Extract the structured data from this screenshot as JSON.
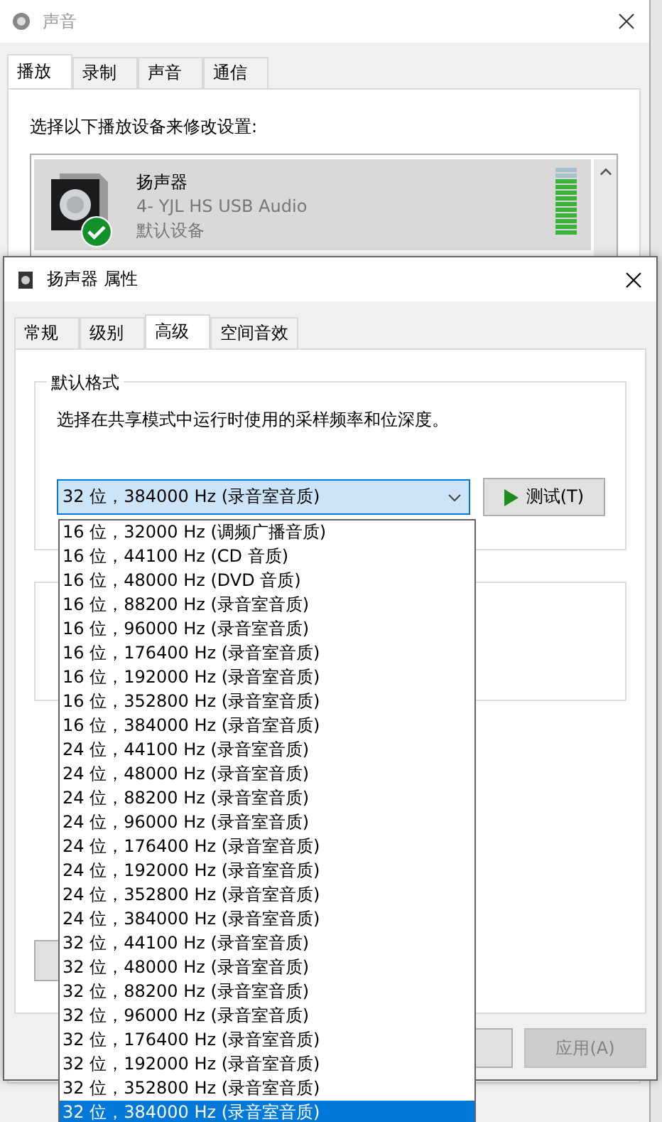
{
  "back_window": {
    "title": "声音",
    "tabs": [
      {
        "label": "播放",
        "selected": true
      },
      {
        "label": "录制",
        "selected": false
      },
      {
        "label": "声音",
        "selected": false
      },
      {
        "label": "通信",
        "selected": false
      }
    ],
    "instruction": "选择以下播放设备来修改设置:",
    "devices": [
      {
        "name": "扬声器",
        "description": "4- YJL HS USB Audio",
        "status": "默认设备",
        "selected": true,
        "is_default": true,
        "level": 0.83
      }
    ]
  },
  "dialog": {
    "title": "扬声器 属性",
    "tabs": [
      {
        "label": "常规",
        "selected": false
      },
      {
        "label": "级别",
        "selected": false
      },
      {
        "label": "高级",
        "selected": true
      },
      {
        "label": "空间音效",
        "selected": false
      }
    ],
    "default_format": {
      "label": "默认格式",
      "description": "选择在共享模式中运行时使用的采样频率和位深度。",
      "value": "32 位，384000 Hz (录音室音质)",
      "expanded": true,
      "test_button": "测试(T)"
    },
    "options": [
      {
        "label": "16 位，32000 Hz (调频广播音质)",
        "selected": false
      },
      {
        "label": "16 位，44100 Hz (CD 音质)",
        "selected": false
      },
      {
        "label": "16 位，48000 Hz (DVD 音质)",
        "selected": false
      },
      {
        "label": "16 位，88200 Hz (录音室音质)",
        "selected": false
      },
      {
        "label": "16 位，96000 Hz (录音室音质)",
        "selected": false
      },
      {
        "label": "16 位，176400 Hz (录音室音质)",
        "selected": false
      },
      {
        "label": "16 位，192000 Hz (录音室音质)",
        "selected": false
      },
      {
        "label": "16 位，352800 Hz (录音室音质)",
        "selected": false
      },
      {
        "label": "16 位，384000 Hz (录音室音质)",
        "selected": false
      },
      {
        "label": "24 位，44100 Hz (录音室音质)",
        "selected": false
      },
      {
        "label": "24 位，48000 Hz (录音室音质)",
        "selected": false
      },
      {
        "label": "24 位，88200 Hz (录音室音质)",
        "selected": false
      },
      {
        "label": "24 位，96000 Hz (录音室音质)",
        "selected": false
      },
      {
        "label": "24 位，176400 Hz (录音室音质)",
        "selected": false
      },
      {
        "label": "24 位，192000 Hz (录音室音质)",
        "selected": false
      },
      {
        "label": "24 位，352800 Hz (录音室音质)",
        "selected": false
      },
      {
        "label": "24 位，384000 Hz (录音室音质)",
        "selected": false
      },
      {
        "label": "32 位，44100 Hz (录音室音质)",
        "selected": false
      },
      {
        "label": "32 位，48000 Hz (录音室音质)",
        "selected": false
      },
      {
        "label": "32 位，88200 Hz (录音室音质)",
        "selected": false
      },
      {
        "label": "32 位，96000 Hz (录音室音质)",
        "selected": false
      },
      {
        "label": "32 位，176400 Hz (录音室音质)",
        "selected": false
      },
      {
        "label": "32 位，192000 Hz (录音室音质)",
        "selected": false
      },
      {
        "label": "32 位，352800 Hz (录音室音质)",
        "selected": false
      },
      {
        "label": "32 位，384000 Hz (录音室音质)",
        "selected": true
      }
    ],
    "apply_button": {
      "label": "应用(A)",
      "disabled": true
    }
  }
}
